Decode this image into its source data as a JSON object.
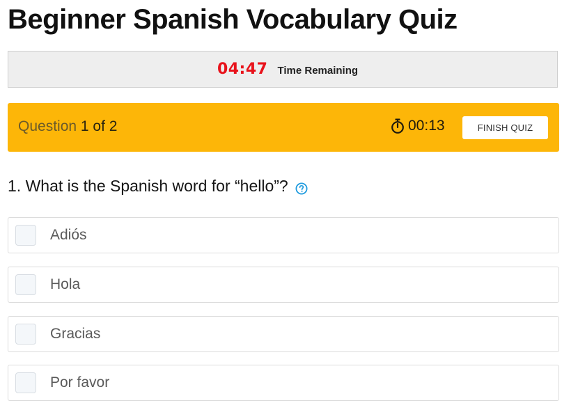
{
  "page": {
    "title": "Beginner Spanish Vocabulary Quiz"
  },
  "timer": {
    "value": "04:47",
    "label": "Time Remaining",
    "color": "#e8121b"
  },
  "question_bar": {
    "prefix": "Question",
    "counter": "1 of 2",
    "elapsed": "00:13",
    "finish_label": "FINISH QUIZ",
    "background": "#fdb608",
    "icon": "stopwatch-icon"
  },
  "question": {
    "text": "1. What is the Spanish word for “hello”?",
    "help_icon": "help-circle-icon",
    "help_color": "#1f9bde"
  },
  "options": [
    {
      "label": "Adiós",
      "checked": false
    },
    {
      "label": "Hola",
      "checked": false
    },
    {
      "label": "Gracias",
      "checked": false
    },
    {
      "label": "Por favor",
      "checked": false
    }
  ]
}
